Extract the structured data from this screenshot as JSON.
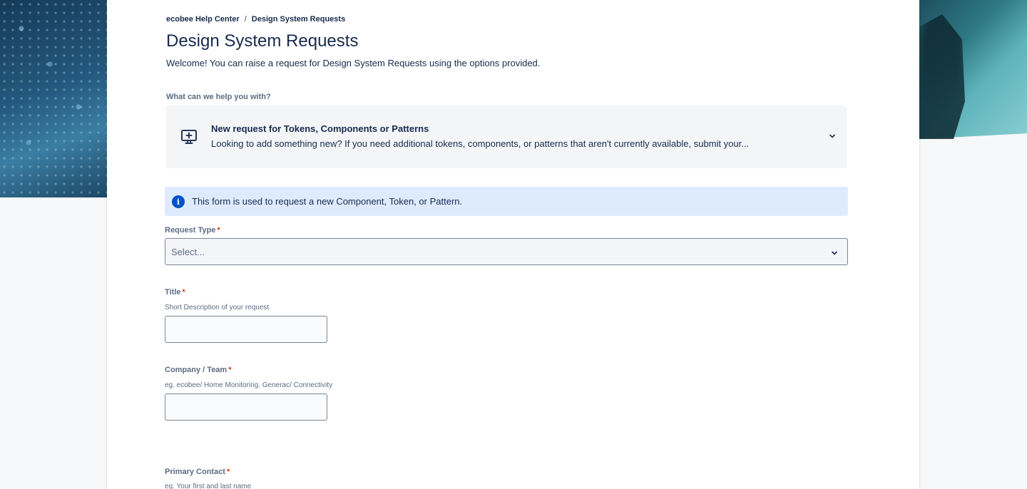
{
  "breadcrumb": {
    "home": "ecobee Help Center",
    "separator": "/",
    "current": "Design System Requests"
  },
  "page": {
    "title": "Design System Requests",
    "welcome": "Welcome! You can raise a request for Design System Requests using the options provided."
  },
  "request_selector": {
    "label": "What can we help you with?",
    "selected_title": "New request for Tokens, Components or Patterns",
    "selected_description": "Looking to add something new? If you need additional tokens, components, or patterns that aren't currently available, submit your...",
    "icon": "monitor-plus-icon"
  },
  "info_banner": {
    "icon": "info-icon",
    "glyph": "i",
    "text": "This form is used to request a new Component, Token, or Pattern."
  },
  "form": {
    "required_marker": "*",
    "request_type": {
      "label": "Request Type",
      "placeholder": "Select..."
    },
    "title": {
      "label": "Title",
      "help": "Short Description of your request",
      "value": ""
    },
    "company_team": {
      "label": "Company / Team",
      "help": "eg. ecobee/ Home Monitoring.  Generac/ Connectivity",
      "value": ""
    },
    "primary_contact": {
      "label": "Primary Contact",
      "help": "eg. Your first and last name"
    }
  },
  "colors": {
    "text": "#172b4d",
    "muted": "#5e6c84",
    "required": "#de350b",
    "info_bg": "#deebff",
    "info_icon": "#0052cc",
    "card_bg": "#f4f5f7"
  }
}
